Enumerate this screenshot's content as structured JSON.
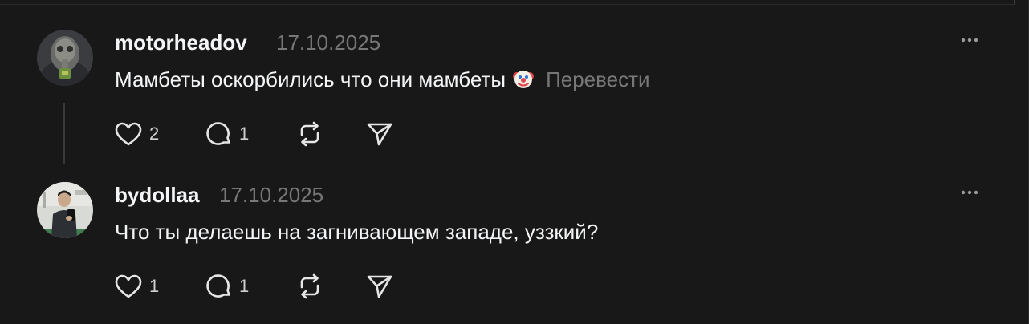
{
  "colors": {
    "background": "#181818",
    "primary_text": "#f3f5f7",
    "secondary_text": "#777777",
    "icon": "#e6e6e6"
  },
  "posts": [
    {
      "username": "motorheadov",
      "date": "17.10.2025",
      "text": "Мамбеты оскорбились что они мамбеты",
      "emoji": "clown-face-emoji",
      "translate_label": "Перевести",
      "likes": "2",
      "replies": "1"
    },
    {
      "username": "bydollaa",
      "date": "17.10.2025",
      "text": "Что ты делаешь на загнивающем западе, уззкий?",
      "likes": "1",
      "replies": "1"
    }
  ]
}
